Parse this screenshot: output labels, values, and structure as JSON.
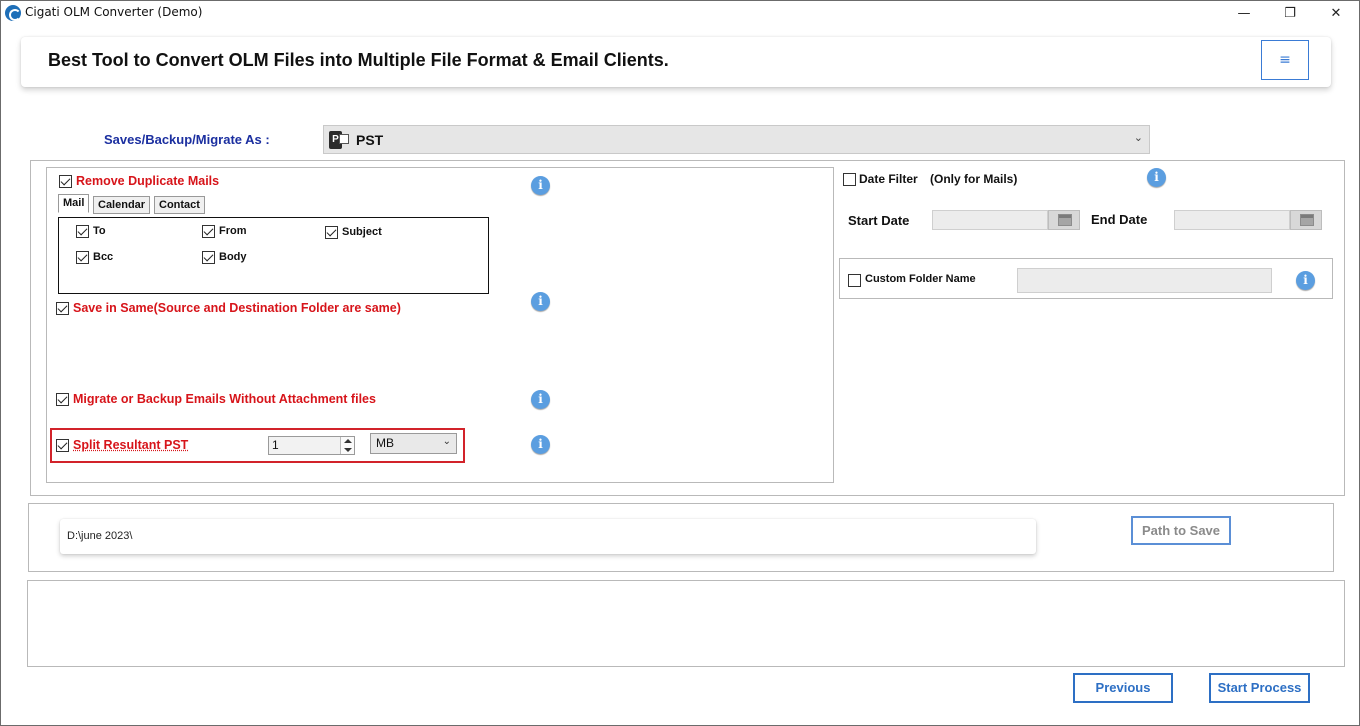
{
  "window": {
    "title": "Cigati OLM Converter (Demo)",
    "minimize_glyph": "—",
    "maximize_glyph": "❐",
    "close_glyph": "✕"
  },
  "header": {
    "title": "Best Tool to Convert OLM Files into Multiple File Format & Email Clients.",
    "menu_glyph": "≡"
  },
  "saveas": {
    "label": "Saves/Backup/Migrate As :",
    "selected": "PST",
    "icon_letter": "P",
    "chevron": "⌄"
  },
  "options": {
    "remove_duplicates": {
      "label": "Remove Duplicate Mails",
      "checked": true
    },
    "tabs": [
      "Mail",
      "Calendar",
      "Contact"
    ],
    "active_tab": "Mail",
    "mail_fields": [
      {
        "label": "To",
        "checked": true
      },
      {
        "label": "From",
        "checked": true
      },
      {
        "label": "Subject",
        "checked": true
      },
      {
        "label": "Bcc",
        "checked": true
      },
      {
        "label": "Body",
        "checked": true
      }
    ],
    "save_in_same": {
      "label": "Save in Same(Source and Destination Folder are same)",
      "checked": true
    },
    "without_attachments": {
      "label": "Migrate or Backup Emails Without Attachment files",
      "checked": true
    },
    "split": {
      "label": "Split Resultant PST",
      "checked": true,
      "size": "1",
      "unit": "MB"
    },
    "info_glyph": "i"
  },
  "filters": {
    "date_filter": {
      "label": "Date Filter",
      "note": "(Only for Mails)",
      "checked": false
    },
    "start_date_label": "Start Date",
    "end_date_label": "End Date",
    "start_date": "",
    "end_date": "",
    "custom_folder": {
      "label": "Custom Folder Name",
      "checked": false,
      "value": ""
    }
  },
  "output": {
    "path": "D:\\june 2023\\",
    "path_button": "Path to Save"
  },
  "nav": {
    "previous": "Previous",
    "start": "Start Process"
  },
  "colors": {
    "accent_blue": "#2d6fc4",
    "label_red": "#d7141a",
    "saveas_blue": "#1b2fa0",
    "highlight_red": "#d2232a"
  }
}
